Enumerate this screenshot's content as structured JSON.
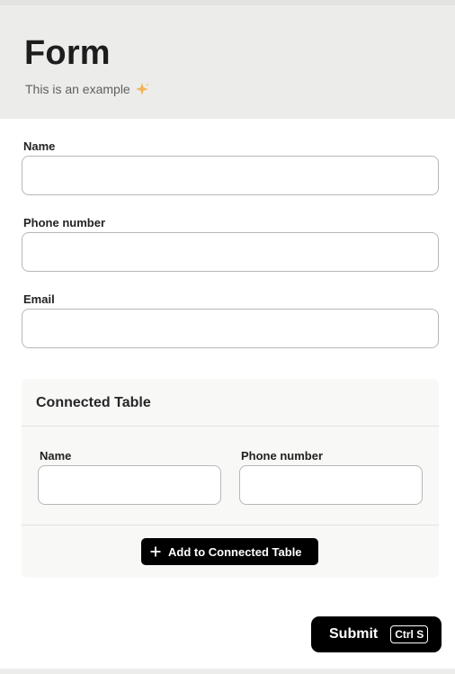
{
  "header": {
    "title": "Form",
    "subtitle": "This is an example"
  },
  "fields": [
    {
      "label": "Name",
      "value": "",
      "placeholder": ""
    },
    {
      "label": "Phone number",
      "value": "",
      "placeholder": ""
    },
    {
      "label": "Email",
      "value": "",
      "placeholder": ""
    }
  ],
  "connected_table": {
    "title": "Connected Table",
    "columns": [
      {
        "label": "Name",
        "value": ""
      },
      {
        "label": "Phone number",
        "value": ""
      }
    ],
    "add_label": "Add to Connected Table"
  },
  "submit": {
    "label": "Submit",
    "shortcut": "Ctrl S"
  },
  "icons": {
    "subtitle_emoji": "sparkles-icon",
    "add": "plus-icon"
  },
  "colors": {
    "header_bg": "#ecedea",
    "button_bg": "#000000",
    "card_bg": "#f8f8f7",
    "sparkle": "#f2b35a"
  }
}
